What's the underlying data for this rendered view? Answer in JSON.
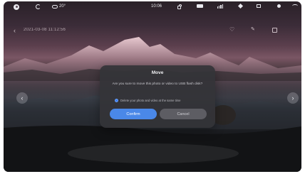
{
  "status_bar": {
    "weather": "20°",
    "time": "10:06"
  },
  "photo_bar": {
    "title": "2021-03-08 11:12:56"
  },
  "dialog": {
    "title": "Move",
    "message": "Are you sure to move this photo or video to USB flash disk?",
    "checkbox_label": "Delete your photo and video at the same time",
    "confirm_label": "Confirm",
    "cancel_label": "Cancel"
  },
  "icons": {
    "avatar": "avatar-icon",
    "sync": "sync-icon",
    "weather": "cloud-icon",
    "lock": "lock-icon",
    "battery": "battery-icon",
    "signal": "signal-icon",
    "settings": "diamond-icon",
    "screen": "screen-icon",
    "volume": "volume-icon",
    "wifi": "wifi-icon",
    "prev": "chevron-left-icon",
    "next": "chevron-right-icon"
  },
  "colors": {
    "primary_button": "#4a88e8",
    "secondary_button": "#5d5d63",
    "dialog_bg": "#343438"
  }
}
